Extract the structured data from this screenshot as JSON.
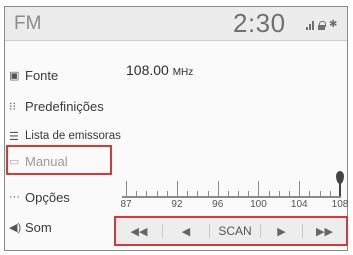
{
  "header": {
    "title": "FM",
    "clock": "2:30",
    "status_icons": [
      "signal-icon",
      "lock-icon",
      "bluetooth-icon"
    ]
  },
  "sidebar": {
    "items": [
      {
        "label": "Fonte",
        "icon": "source-icon"
      },
      {
        "label": "Predefinições",
        "icon": "presets-icon"
      },
      {
        "label": "Lista de emissoras",
        "icon": "station-list-icon"
      },
      {
        "label": "Manual",
        "icon": "manual-icon",
        "state": "disabled"
      },
      {
        "label": "Opções",
        "icon": "options-icon"
      },
      {
        "label": "Som",
        "icon": "sound-icon"
      }
    ]
  },
  "tuner": {
    "frequency": "108.00",
    "unit": "MHz",
    "scale_labels": [
      "87",
      "92",
      "96",
      "100",
      "104",
      "108"
    ],
    "scale_min": 87,
    "scale_max": 108,
    "needle_value": 108
  },
  "controls": {
    "seek_back": "◀◀",
    "step_back": "◀",
    "scan": "SCAN",
    "step_forward": "▶",
    "seek_forward": "▶▶"
  },
  "colors": {
    "highlight": "#d43a3a",
    "header_bg": "#ececec",
    "control_bar_bg": "#ededed"
  }
}
